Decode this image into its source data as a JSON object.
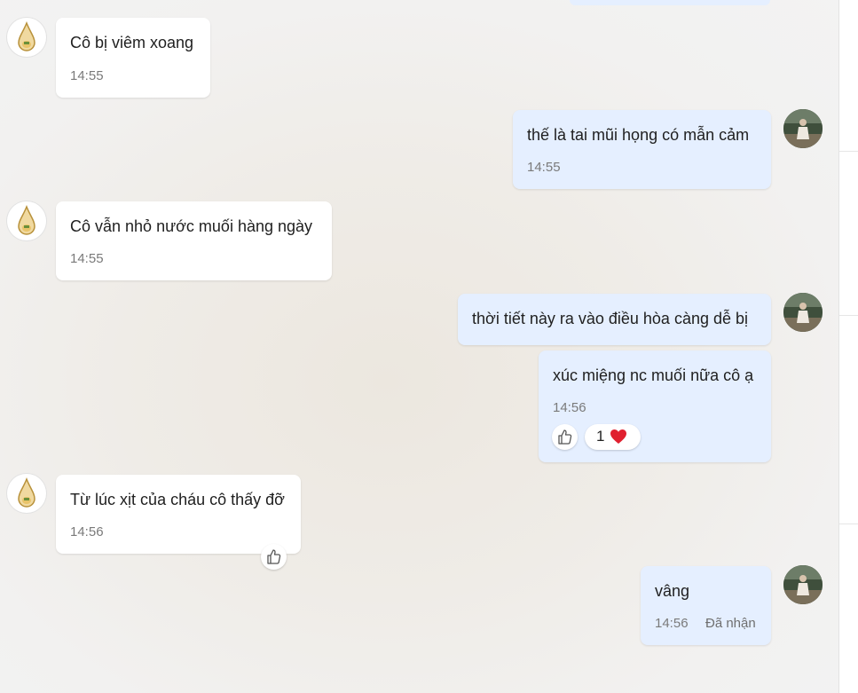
{
  "colors": {
    "incoming_bubble": "#ffffff",
    "outgoing_bubble": "#e5efff",
    "time_text": "#7a7a7a",
    "heart": "#e0202f"
  },
  "messages": [
    {
      "side": "incoming",
      "text": "Cô bị viêm xoang",
      "time": "14:55",
      "avatar": "logo-drop-avatar"
    },
    {
      "side": "outgoing",
      "text": "thế là tai mũi họng có mẫn cảm",
      "time": "14:55",
      "avatar": "user-photo-avatar"
    },
    {
      "side": "incoming",
      "text": "Cô vẫn nhỏ nước muối hàng ngày",
      "time": "14:55",
      "avatar": "logo-drop-avatar"
    },
    {
      "side": "outgoing",
      "text": "thời tiết này ra vào điều hòa càng dễ bị",
      "avatar": "user-photo-avatar"
    },
    {
      "side": "outgoing",
      "text": "xúc miệng nc muối nữa cô ạ",
      "time": "14:56",
      "reaction_count": "1",
      "reaction_icon": "heart-icon"
    },
    {
      "side": "incoming",
      "text": "Từ lúc xịt của cháu cô thấy đỡ",
      "time": "14:56",
      "avatar": "logo-drop-avatar"
    },
    {
      "side": "outgoing",
      "text": "vâng",
      "time": "14:56",
      "status": "Đã nhận",
      "avatar": "user-photo-avatar"
    }
  ]
}
